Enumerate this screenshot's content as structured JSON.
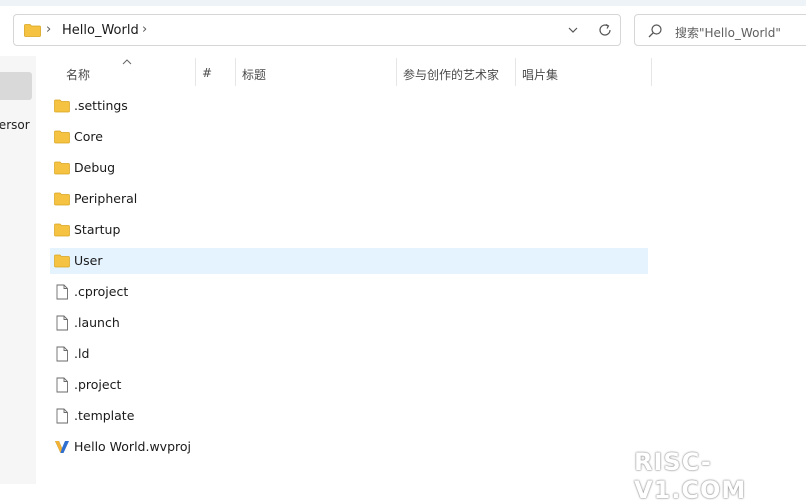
{
  "address_bar": {
    "path": "Hello_World"
  },
  "search": {
    "placeholder": "搜索\"Hello_World\""
  },
  "left_pane": {
    "clipped_text": "Persor"
  },
  "columns": [
    "名称",
    "#",
    "标题",
    "参与创作的艺术家",
    "唱片集"
  ],
  "items": [
    {
      "label": ".settings",
      "icon": "folder-icon"
    },
    {
      "label": "Core",
      "icon": "folder-icon"
    },
    {
      "label": "Debug",
      "icon": "folder-icon"
    },
    {
      "label": "Peripheral",
      "icon": "folder-icon"
    },
    {
      "label": "Startup",
      "icon": "folder-icon"
    },
    {
      "label": "User",
      "icon": "folder-icon",
      "selected": true
    },
    {
      "label": ".cproject",
      "icon": "file-icon"
    },
    {
      "label": ".launch",
      "icon": "file-icon"
    },
    {
      "label": ".ld",
      "icon": "file-icon"
    },
    {
      "label": ".project",
      "icon": "file-icon"
    },
    {
      "label": ".template",
      "icon": "file-icon"
    },
    {
      "label": "Hello World.wvproj",
      "icon": "project-file-icon"
    }
  ],
  "watermark": "RISC-V1.COM",
  "colors": {
    "folder": "#f5c242",
    "selection": "#e5f3ff",
    "accent": "#3a6fd8"
  }
}
